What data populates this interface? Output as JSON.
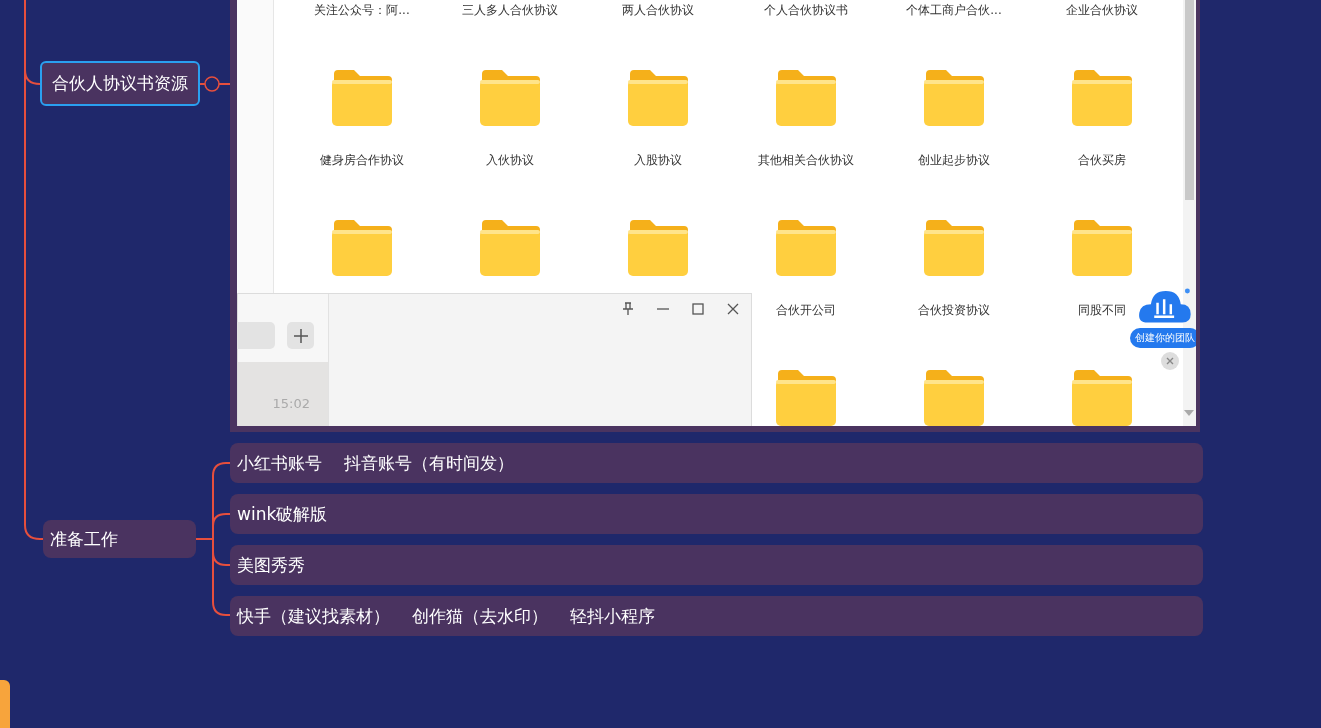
{
  "resource_node": {
    "label": "合伙人协议书资源",
    "selected": true
  },
  "embedded_screenshot": {
    "grid": [
      [
        {
          "kind": "label",
          "text": "关注公众号：阿..."
        },
        {
          "kind": "label",
          "text": "三人多人合伙协议"
        },
        {
          "kind": "label",
          "text": "两人合伙协议"
        },
        {
          "kind": "label",
          "text": "个人合伙协议书"
        },
        {
          "kind": "label",
          "text": "个体工商户合伙..."
        },
        {
          "kind": "label",
          "text": "企业合伙协议"
        }
      ],
      [
        {
          "kind": "folder"
        },
        {
          "kind": "folder"
        },
        {
          "kind": "folder"
        },
        {
          "kind": "folder"
        },
        {
          "kind": "folder"
        },
        {
          "kind": "folder"
        }
      ],
      [
        {
          "kind": "label",
          "text": "健身房合作协议"
        },
        {
          "kind": "label",
          "text": "入伙协议"
        },
        {
          "kind": "label",
          "text": "入股协议"
        },
        {
          "kind": "label",
          "text": "其他相关合伙协议"
        },
        {
          "kind": "label",
          "text": "创业起步协议"
        },
        {
          "kind": "label",
          "text": "合伙买房"
        }
      ],
      [
        {
          "kind": "folder"
        },
        {
          "kind": "folder"
        },
        {
          "kind": "folder"
        },
        {
          "kind": "folder"
        },
        {
          "kind": "folder"
        },
        {
          "kind": "folder"
        }
      ],
      [
        {
          "kind": "empty"
        },
        {
          "kind": "empty"
        },
        {
          "kind": "empty"
        },
        {
          "kind": "label",
          "text": "合伙开公司"
        },
        {
          "kind": "label",
          "text": "合伙投资协议"
        },
        {
          "kind": "label",
          "text": "同股不同"
        }
      ],
      [
        {
          "kind": "empty"
        },
        {
          "kind": "empty"
        },
        {
          "kind": "empty"
        },
        {
          "kind": "folder"
        },
        {
          "kind": "folder"
        },
        {
          "kind": "folder"
        }
      ]
    ],
    "chat_window": {
      "time": "15:02"
    },
    "badge": {
      "label": "创建你的团队"
    }
  },
  "prep_node": {
    "label": "准备工作",
    "children": [
      {
        "items": [
          "小红书账号",
          "抖音账号（有时间发）"
        ]
      },
      {
        "items": [
          "wink破解版"
        ]
      },
      {
        "items": [
          "美图秀秀"
        ]
      },
      {
        "items": [
          "快手（建议找素材）",
          "创作猫（去水印）",
          "轻抖小程序"
        ]
      }
    ]
  }
}
